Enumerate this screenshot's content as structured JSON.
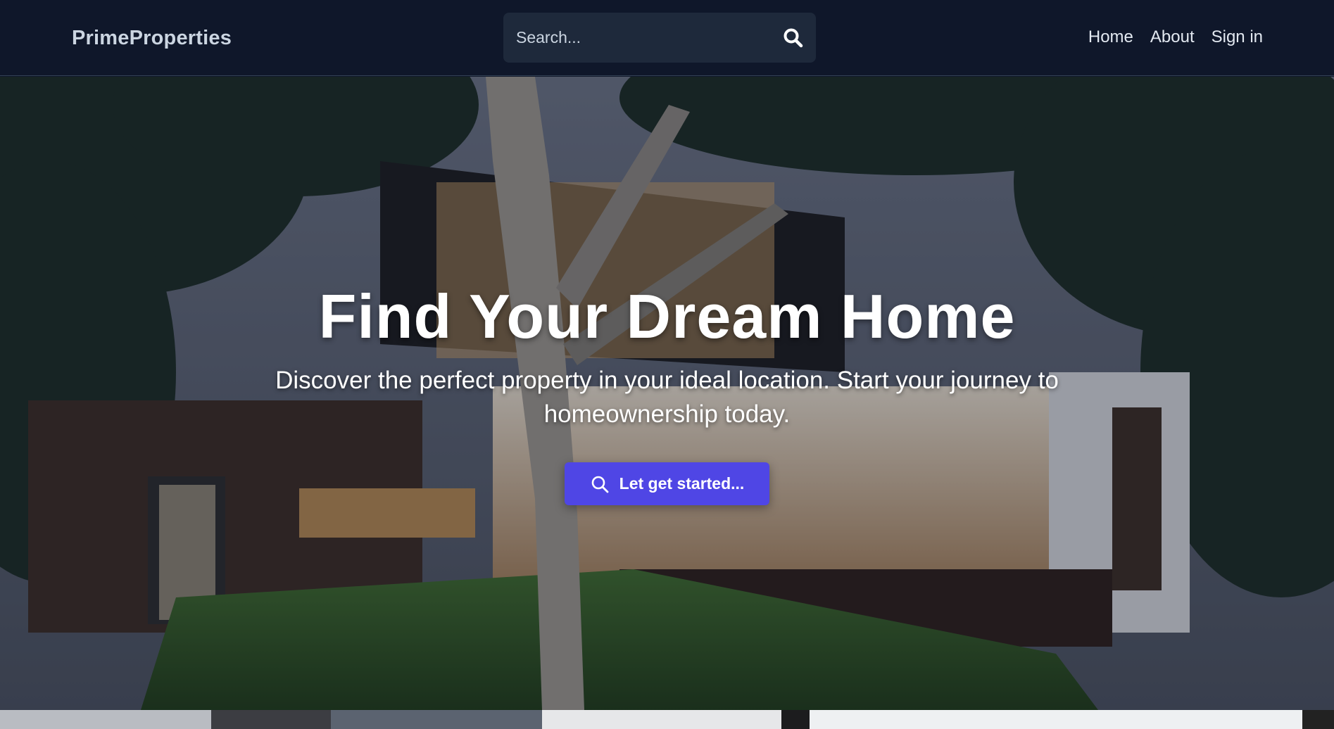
{
  "brand": {
    "name": "PrimeProperties"
  },
  "search": {
    "placeholder": "Search..."
  },
  "nav": {
    "items": [
      {
        "label": "Home"
      },
      {
        "label": "About"
      },
      {
        "label": "Sign in"
      }
    ]
  },
  "hero": {
    "title": "Find Your Dream Home",
    "subtitle": "Discover the perfect property in your ideal location. Start your journey to homeownership today.",
    "cta_label": "Let get started...",
    "cta_icon": "search-icon"
  },
  "colors": {
    "navbar_bg": "#0f172a",
    "search_bg": "#1e293b",
    "accent": "#4f46e5",
    "brand_text": "#cbd5e1"
  }
}
